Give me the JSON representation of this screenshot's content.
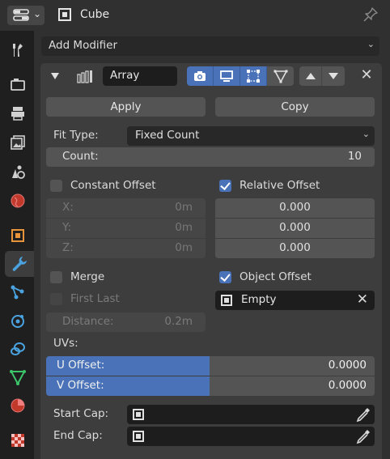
{
  "header": {
    "editor_icon": "properties-editor-icon",
    "object_name": "Cube",
    "pin_icon": "pin-icon"
  },
  "tabs": [
    {
      "name": "tool",
      "icon": "wrench-screwdriver-icon"
    },
    {
      "name": "render",
      "icon": "camera-back-icon"
    },
    {
      "name": "output",
      "icon": "printer-icon"
    },
    {
      "name": "view-layer",
      "icon": "image-stack-icon"
    },
    {
      "name": "scene",
      "icon": "scene-icon"
    },
    {
      "name": "world",
      "icon": "globe-icon"
    },
    {
      "name": "object",
      "icon": "object-icon"
    },
    {
      "name": "modifiers",
      "icon": "wrench-icon",
      "active": true
    },
    {
      "name": "particles",
      "icon": "particles-icon"
    },
    {
      "name": "physics",
      "icon": "physics-icon"
    },
    {
      "name": "constraints",
      "icon": "constraints-icon"
    },
    {
      "name": "data",
      "icon": "mesh-data-icon"
    },
    {
      "name": "material",
      "icon": "material-sphere-icon"
    },
    {
      "name": "texture",
      "icon": "checker-texture-icon"
    }
  ],
  "panel": {
    "add_modifier": "Add Modifier",
    "modifier": {
      "name": "Array",
      "apply": "Apply",
      "copy": "Copy",
      "fit_type_label": "Fit Type:",
      "fit_type_value": "Fixed Count",
      "count_label": "Count:",
      "count_value": "10",
      "constant_offset": {
        "label": "Constant Offset",
        "checked": false,
        "x_label": "X:",
        "x": "0m",
        "y_label": "Y:",
        "y": "0m",
        "z_label": "Z:",
        "z": "0m"
      },
      "relative_offset": {
        "label": "Relative Offset",
        "checked": true,
        "x": "0.000",
        "y": "0.000",
        "z": "0.000"
      },
      "merge": {
        "label": "Merge",
        "checked": false
      },
      "first_last": {
        "label": "First Last",
        "checked": false
      },
      "distance_label": "Distance:",
      "distance_value": "0.2m",
      "object_offset": {
        "label": "Object Offset",
        "checked": true,
        "object": "Empty"
      },
      "uvs_label": "UVs:",
      "u_offset_label": "U Offset:",
      "u_offset_value": "0.0000",
      "v_offset_label": "V Offset:",
      "v_offset_value": "0.0000",
      "start_cap_label": "Start Cap:",
      "end_cap_label": "End Cap:"
    }
  },
  "colors": {
    "accent": "#4a72b8",
    "panel_bg": "#303030",
    "box_bg": "#3d3d3d",
    "field_bg": "#545454",
    "dark_field_bg": "#1d1d1d"
  }
}
